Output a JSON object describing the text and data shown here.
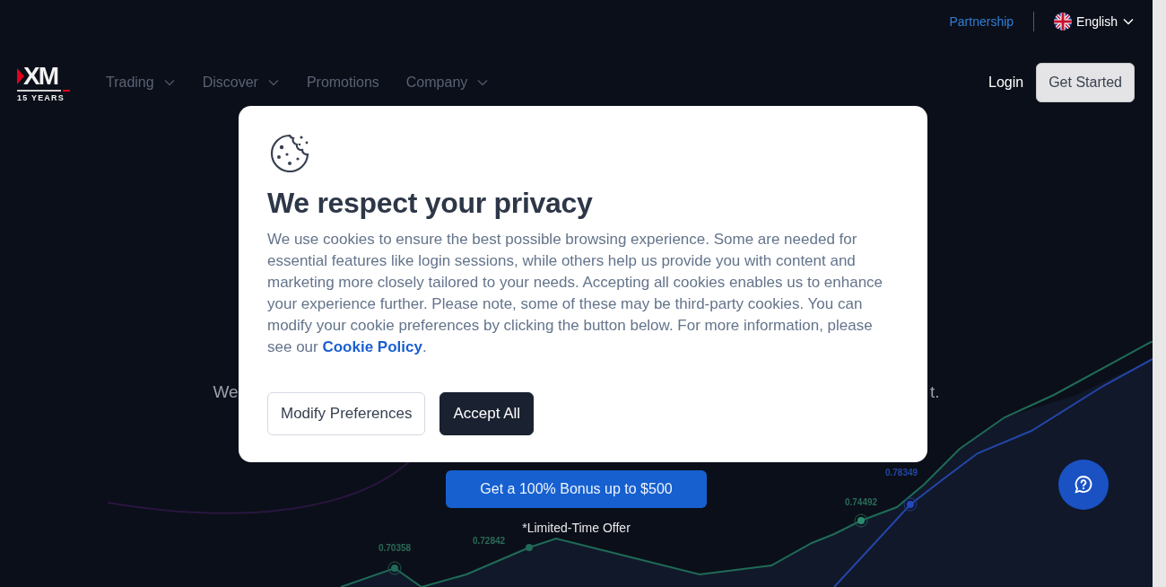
{
  "logo": {
    "wordmark": "XM",
    "tagline": "15 YEARS"
  },
  "top_bar": {
    "partnership_link": "Partnership",
    "language": "English"
  },
  "nav": {
    "items": [
      {
        "label": "Trading",
        "has_menu": true
      },
      {
        "label": "Discover",
        "has_menu": true
      },
      {
        "label": "Promotions",
        "has_menu": false
      },
      {
        "label": "Company",
        "has_menu": true
      }
    ],
    "login": "Login",
    "get_started": "Get Started"
  },
  "hero": {
    "text_start": "We",
    "text_end": "t.",
    "bonus_button": "Get a 100% Bonus up to $500",
    "offer_note": "*Limited-Time Offer",
    "price_labels": [
      {
        "text": "0.70358",
        "kind": "green"
      },
      {
        "text": "0.72842",
        "kind": "green"
      },
      {
        "text": "0.74492",
        "kind": "green"
      },
      {
        "text": "0.78349",
        "kind": "blue"
      }
    ]
  },
  "cookie_dialog": {
    "title": "We respect your privacy",
    "body": "We use cookies to ensure the best possible browsing experience. Some are needed for essential features like login sessions, while others help us provide you with content and marketing more closely tailored to your needs. Accepting all cookies enables us to enhance your experience further. Please note, some of these may be third-party cookies. You can modify your cookie preferences by clicking the button below. For more information, please see our ",
    "policy_link": "Cookie Policy",
    "body_end": ".",
    "buttons": [
      {
        "label": "Modify Preferences",
        "kind": "secondary"
      },
      {
        "label": "Accept All",
        "kind": "primary"
      }
    ]
  }
}
